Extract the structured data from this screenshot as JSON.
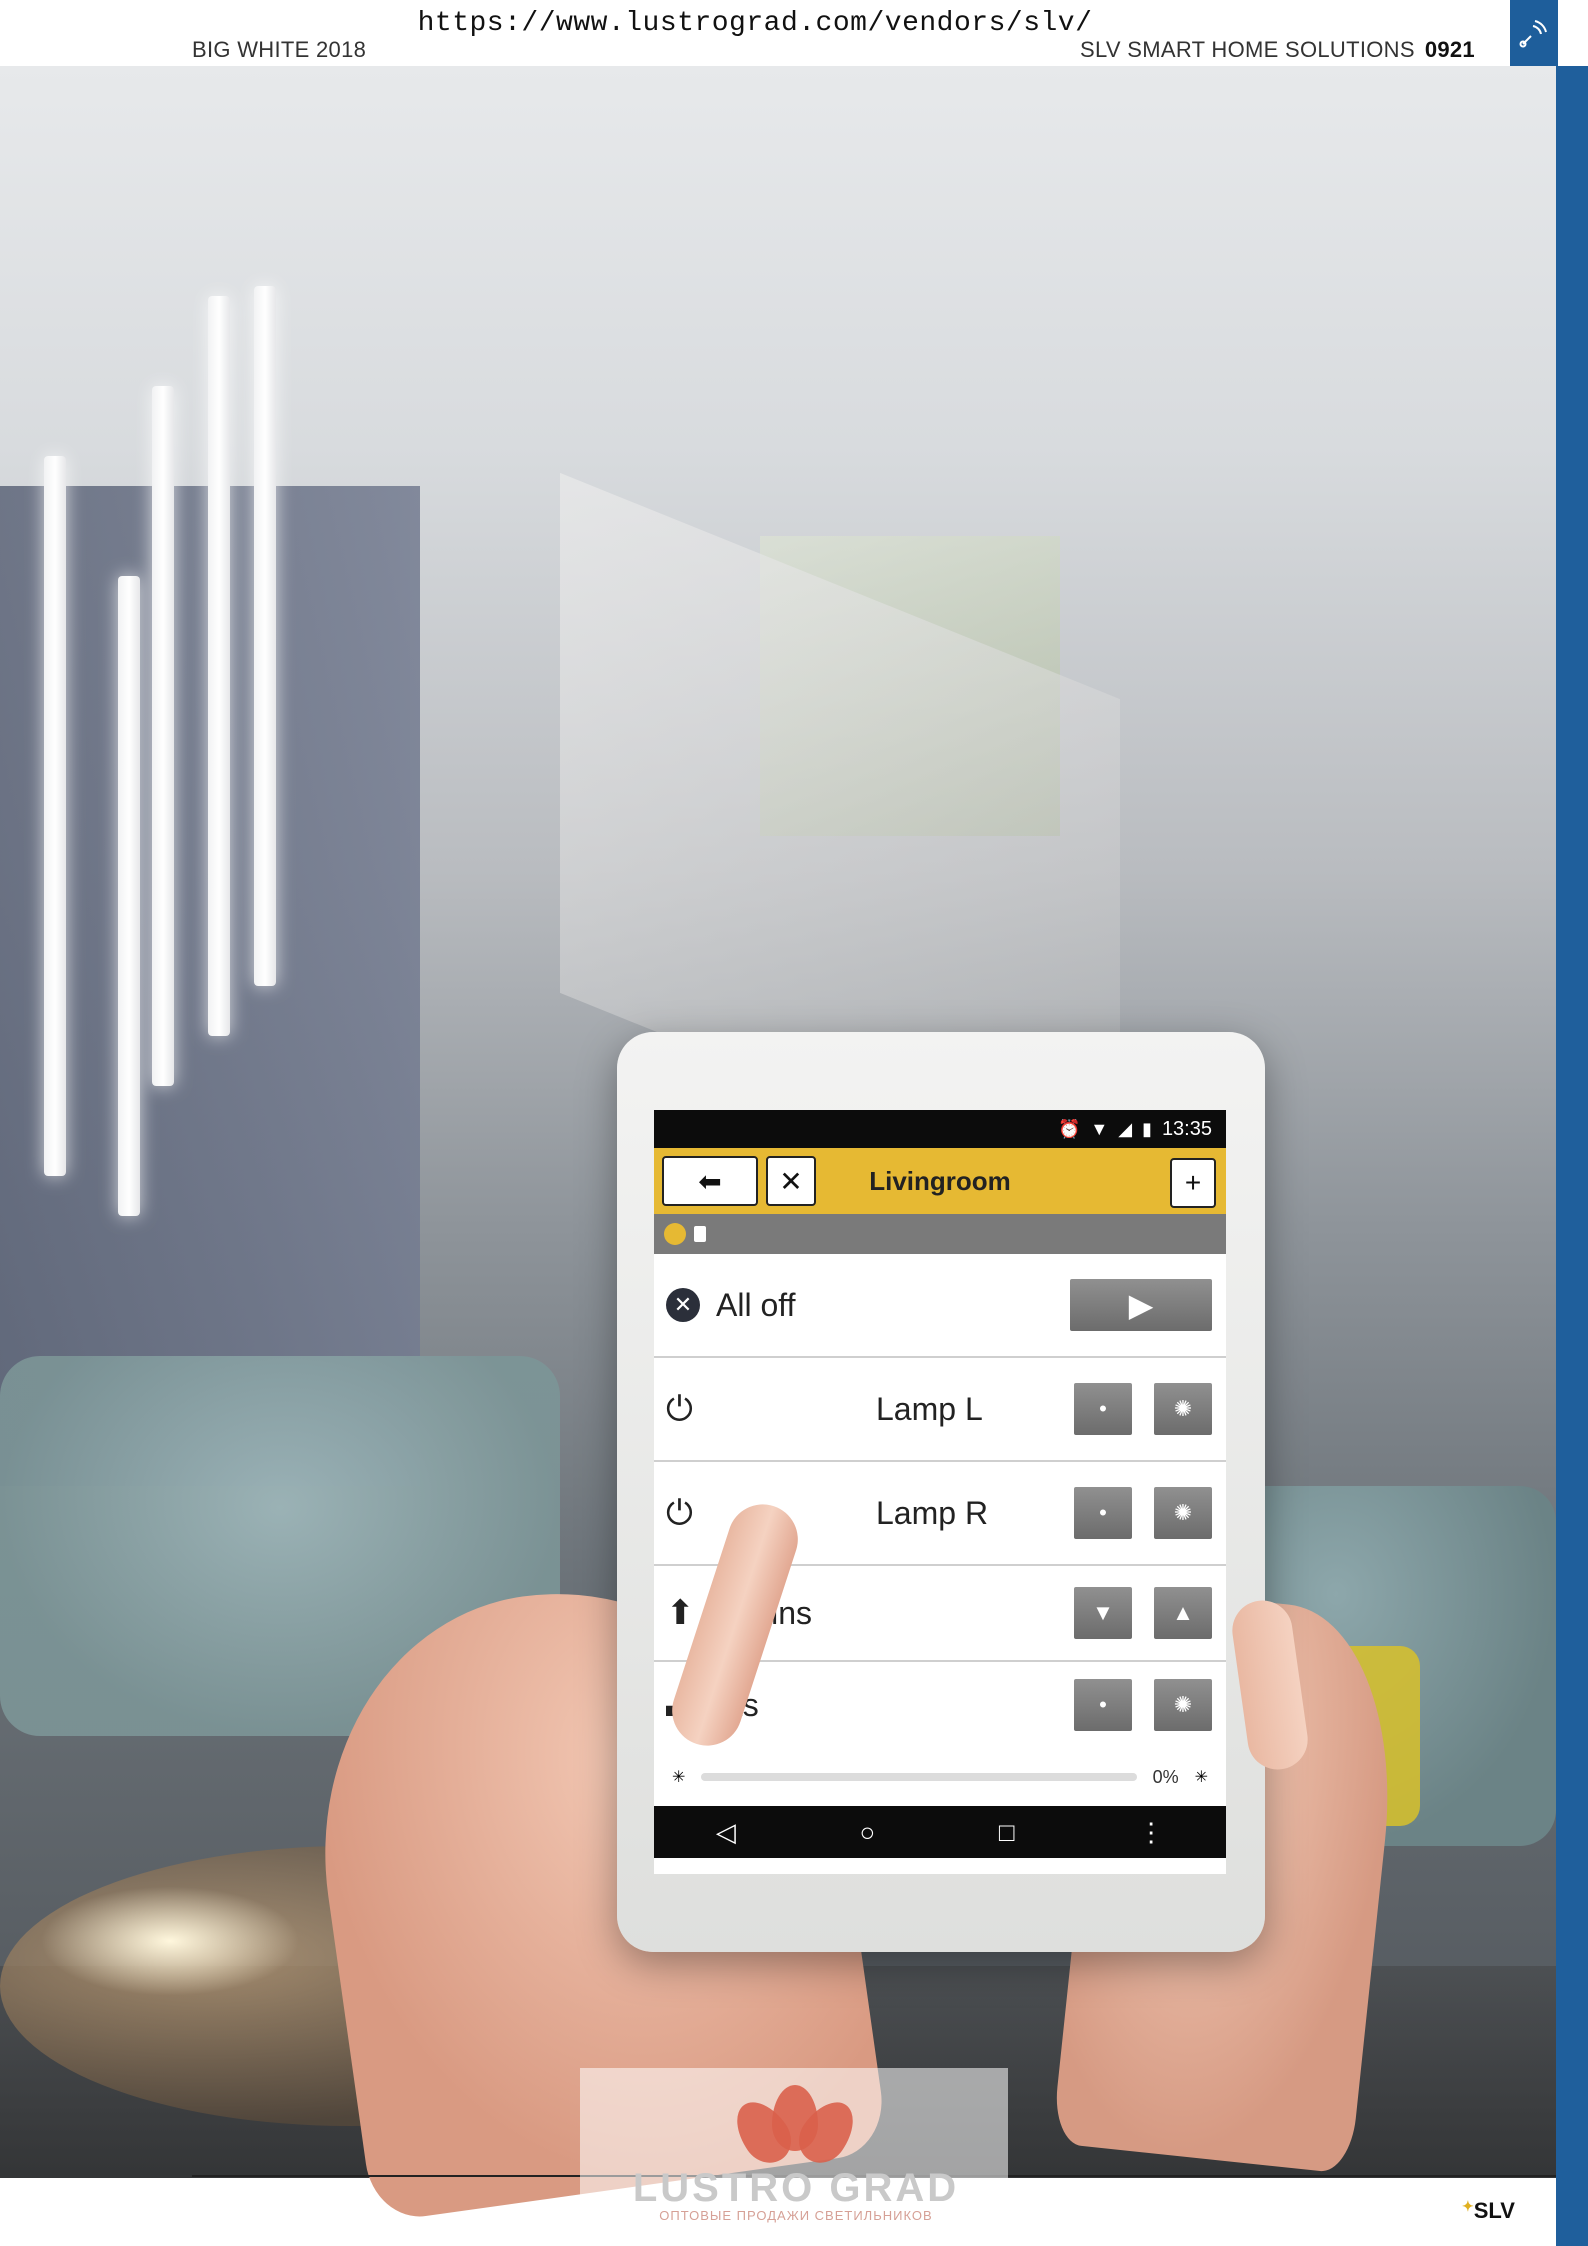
{
  "header": {
    "url": "https://www.lustrograd.com/vendors/slv/",
    "left_title": "BIG WHITE 2018",
    "right_title": "SLV SMART HOME SOLUTIONS",
    "page_number": "0921",
    "tab_icon": "wireless-signal-icon"
  },
  "tablet": {
    "status": {
      "time": "13:35",
      "icons": [
        "alarm-icon",
        "wifi-icon",
        "signal-icon",
        "battery-icon"
      ]
    },
    "appbar": {
      "title": "Livingroom",
      "back_icon": "arrow-left-icon",
      "settings_icon": "tools-icon",
      "add_label": "+"
    },
    "rows": [
      {
        "label": "All off",
        "lead_icon": "close-circle-icon",
        "action_icon": "play-icon"
      },
      {
        "label": "Lamp L",
        "lead_icon": "power-icon",
        "actions": [
          "dim-icon",
          "bright-icon"
        ]
      },
      {
        "label": "Lamp R",
        "lead_icon": "power-icon",
        "actions": [
          "dim-icon",
          "bright-icon"
        ]
      },
      {
        "label": "urtains",
        "lead_icon": "arrow-up-icon",
        "actions": [
          "arrow-down-icon",
          "arrow-up-icon"
        ]
      },
      {
        "label": "hts",
        "lead_icon": "bulb-icon",
        "actions": [
          "dim-icon",
          "bright-icon"
        ]
      }
    ],
    "slider": {
      "value_label": "0%",
      "value": 0
    },
    "nav": [
      "back-triangle-icon",
      "home-circle-icon",
      "recents-square-icon",
      "menu-dots-icon"
    ]
  },
  "watermark": {
    "brand": "LUSTRO GRAD",
    "tagline": "ОПТОВЫЕ ПРОДАЖИ СВЕТИЛЬНИКОВ"
  },
  "footer": {
    "brand": "SLV"
  },
  "colors": {
    "accent_blue": "#1e5e9b",
    "app_yellow": "#e6b933",
    "watermark_red": "#d9604b"
  }
}
